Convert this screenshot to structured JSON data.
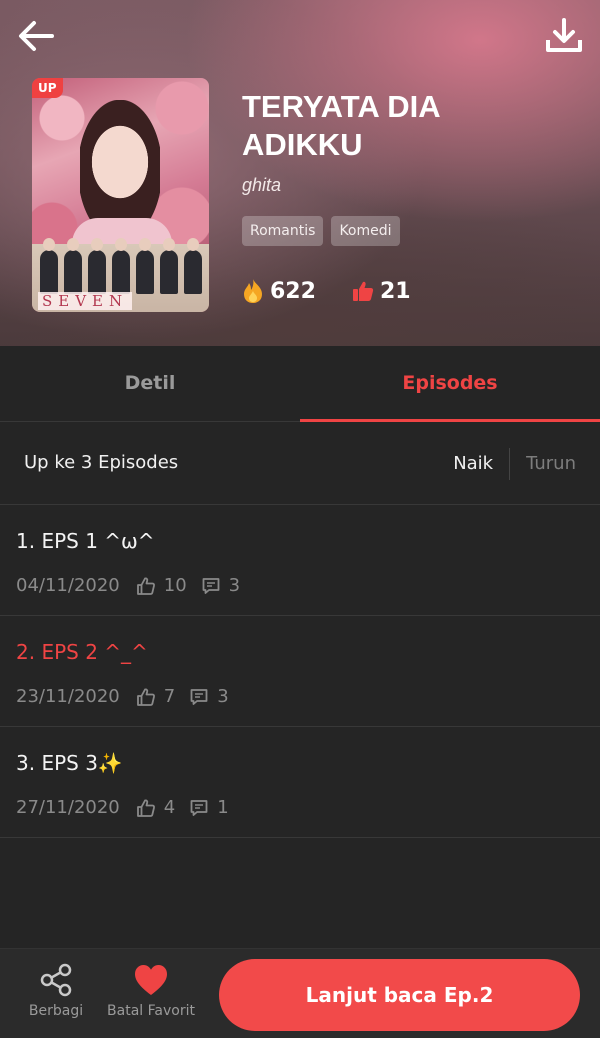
{
  "header": {
    "cover_badge": "UP",
    "cover_caption": "SEVEN",
    "title": "TERYATA DIA ADIKKU",
    "author": "ghita",
    "tags": [
      "Romantis",
      "Komedi"
    ],
    "views": "622",
    "likes": "21"
  },
  "tabs": [
    {
      "label": "Detil",
      "active": false
    },
    {
      "label": "Episodes",
      "active": true
    }
  ],
  "sortbar": {
    "count_label": "Up ke 3 Episodes",
    "asc_label": "Naik",
    "desc_label": "Turun",
    "selected": "Naik"
  },
  "episodes": [
    {
      "title": "1. EPS 1 ^ω^",
      "date": "04/11/2020",
      "likes": "10",
      "comments": "3",
      "current": false
    },
    {
      "title": "2. EPS 2 ^_^",
      "date": "23/11/2020",
      "likes": "7",
      "comments": "3",
      "current": true
    },
    {
      "title": "3. EPS 3✨",
      "date": "27/11/2020",
      "likes": "4",
      "comments": "1",
      "current": false
    }
  ],
  "bottombar": {
    "share_label": "Berbagi",
    "favorite_label": "Batal Favorit",
    "continue_label": "Lanjut baca Ep.2"
  },
  "colors": {
    "accent": "#ef4444",
    "background": "#252525",
    "muted_text": "#8a8a8a"
  },
  "icons": [
    "back-arrow-icon",
    "download-icon",
    "fire-icon",
    "thumbs-up-icon",
    "comment-icon",
    "share-icon",
    "heart-icon"
  ]
}
